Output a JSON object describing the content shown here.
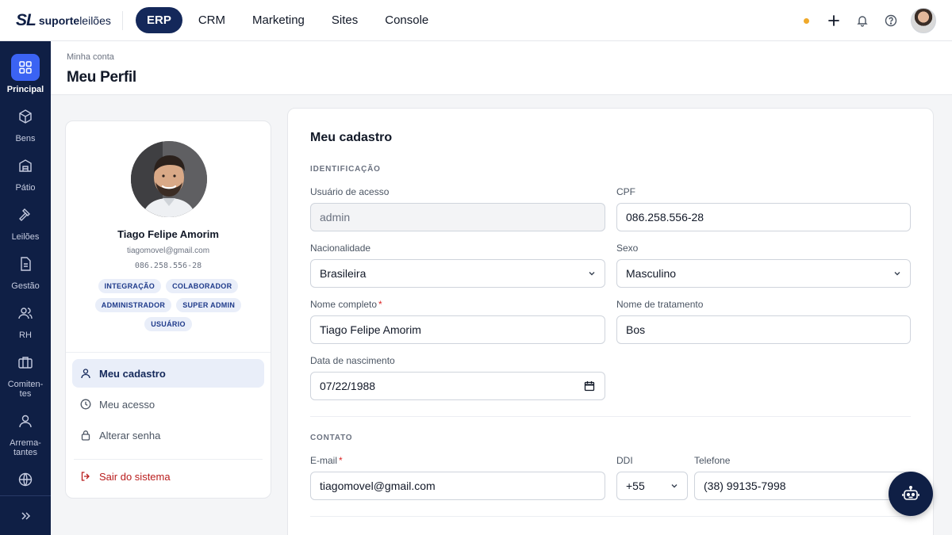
{
  "brand": {
    "mark": "SL",
    "name_bold": "suporte",
    "name_light": "leilões"
  },
  "topnav": [
    {
      "label": "ERP",
      "active": true
    },
    {
      "label": "CRM"
    },
    {
      "label": "Marketing"
    },
    {
      "label": "Sites"
    },
    {
      "label": "Console"
    }
  ],
  "sidebar": {
    "items": [
      {
        "label": "Principal",
        "icon": "grid-icon",
        "active": true
      },
      {
        "label": "Bens",
        "icon": "cube-icon"
      },
      {
        "label": "Pátio",
        "icon": "warehouse-icon"
      },
      {
        "label": "Leilões",
        "icon": "gavel-icon"
      },
      {
        "label": "Gestão",
        "icon": "document-icon"
      },
      {
        "label": "RH",
        "icon": "users-icon"
      },
      {
        "label": "Comiten-\ntes",
        "icon": "briefcase-icon"
      },
      {
        "label": "Arrema-\ntantes",
        "icon": "user-icon"
      },
      {
        "label": "",
        "icon": "globe-icon"
      }
    ],
    "collapse_icon": "chevrons-right-icon"
  },
  "header": {
    "breadcrumb": "Minha conta",
    "title": "Meu Perfil"
  },
  "profile": {
    "name": "Tiago Felipe Amorim",
    "email": "tiagomovel@gmail.com",
    "cpf": "086.258.556-28",
    "badges": [
      "INTEGRAÇÃO",
      "COLABORADOR",
      "ADMINISTRADOR",
      "SUPER ADMIN",
      "USUÁRIO"
    ],
    "menu": {
      "cadastro": "Meu cadastro",
      "acesso": "Meu acesso",
      "senha": "Alterar senha",
      "sair": "Sair do sistema"
    }
  },
  "form": {
    "title": "Meu cadastro",
    "section_id": "IDENTIFICAÇÃO",
    "usuario_label": "Usuário de acesso",
    "usuario_value": "admin",
    "cpf_label": "CPF",
    "cpf_value": "086.258.556-28",
    "nacionalidade_label": "Nacionalidade",
    "nacionalidade_value": "Brasileira",
    "sexo_label": "Sexo",
    "sexo_value": "Masculino",
    "nome_label": "Nome completo",
    "nome_value": "Tiago Felipe Amorim",
    "tratamento_label": "Nome de tratamento",
    "tratamento_value": "Bos",
    "nascimento_label": "Data de nascimento",
    "nascimento_value": "07/22/1988",
    "section_contato": "CONTATO",
    "email_label": "E-mail",
    "email_value": "tiagomovel@gmail.com",
    "ddi_label": "DDI",
    "ddi_value": "+55",
    "telefone_label": "Telefone",
    "telefone_value": "(38) 99135-7998",
    "required_mark": "*"
  },
  "colors": {
    "navy": "#0f1f45",
    "accent": "#3b63f3",
    "status_dot": "#f0a92a",
    "danger": "#b91c1c"
  }
}
